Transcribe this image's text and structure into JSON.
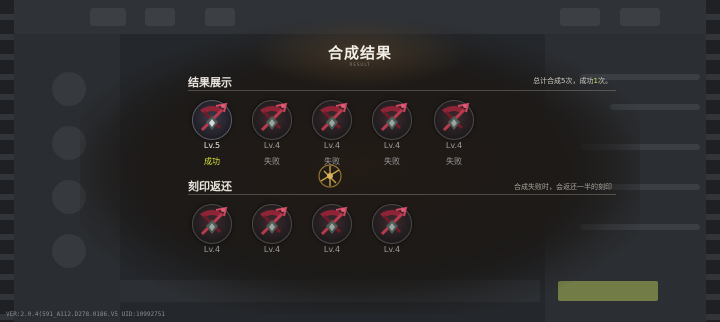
{
  "modal": {
    "title": "合成结果",
    "subtitle": "RESULT"
  },
  "results_section": {
    "label": "结果展示",
    "summary_prefix": "总计合成5次，成功",
    "summary_count": "1",
    "summary_suffix": "次。",
    "items": [
      {
        "level": "Lv.5",
        "status": "成功",
        "success": true
      },
      {
        "level": "Lv.4",
        "status": "失败",
        "success": false
      },
      {
        "level": "Lv.4",
        "status": "失败",
        "success": false
      },
      {
        "level": "Lv.4",
        "status": "失败",
        "success": false
      },
      {
        "level": "Lv.4",
        "status": "失败",
        "success": false
      }
    ]
  },
  "return_section": {
    "label": "刻印返还",
    "note": "合成失败时，会返还一半的刻印",
    "items": [
      {
        "level": "Lv.4"
      },
      {
        "level": "Lv.4"
      },
      {
        "level": "Lv.4"
      },
      {
        "level": "Lv.4"
      }
    ]
  },
  "footer": {
    "version": "VER:2.0.4(591_A112.D278.0186.V5   UID:10992751"
  },
  "colors": {
    "success": "#d8e03c",
    "fail": "#9a9a9a",
    "accent_crimson": "#8e2436"
  },
  "icons": {
    "item": "crossbow-emblem-icon",
    "center_mark": "golden-rune-icon"
  }
}
